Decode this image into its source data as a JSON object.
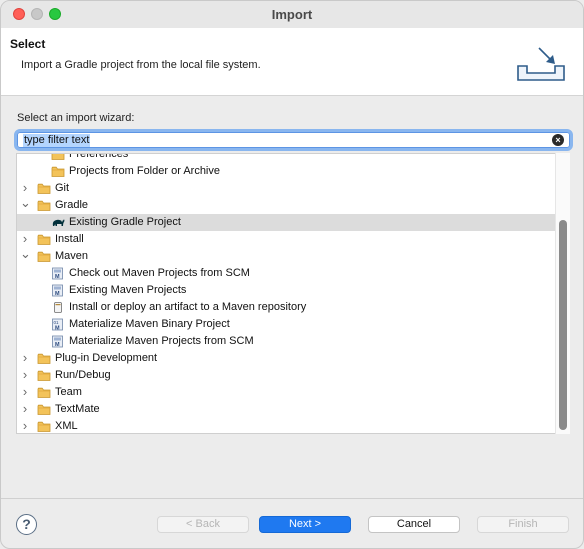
{
  "window": {
    "title": "Import"
  },
  "banner": {
    "title": "Select",
    "message": "Import a Gradle project from the local file system."
  },
  "wizard": {
    "label": "Select an import wizard:",
    "filter_value": "type filter text"
  },
  "tree": [
    {
      "label": "Preferences",
      "level": 1,
      "icon": "preferences-icon",
      "twisty": ""
    },
    {
      "label": "Projects from Folder or Archive",
      "level": 1,
      "icon": "folder-icon",
      "twisty": ""
    },
    {
      "label": "Git",
      "level": 0,
      "icon": "folder-icon",
      "twisty": "collapsed"
    },
    {
      "label": "Gradle",
      "level": 0,
      "icon": "folder-icon",
      "twisty": "expanded"
    },
    {
      "label": "Existing Gradle Project",
      "level": 1,
      "icon": "gradle-elephant-icon",
      "twisty": "",
      "selected": true
    },
    {
      "label": "Install",
      "level": 0,
      "icon": "folder-icon",
      "twisty": "collapsed"
    },
    {
      "label": "Maven",
      "level": 0,
      "icon": "folder-icon",
      "twisty": "expanded"
    },
    {
      "label": "Check out Maven Projects from SCM",
      "level": 1,
      "icon": "maven-icon",
      "twisty": ""
    },
    {
      "label": "Existing Maven Projects",
      "level": 1,
      "icon": "maven-icon",
      "twisty": ""
    },
    {
      "label": "Install or deploy an artifact to a Maven repository",
      "level": 1,
      "icon": "jar-icon",
      "twisty": ""
    },
    {
      "label": "Materialize Maven Binary Project",
      "level": 1,
      "icon": "maven-binary-icon",
      "twisty": ""
    },
    {
      "label": "Materialize Maven Projects from SCM",
      "level": 1,
      "icon": "maven-icon",
      "twisty": ""
    },
    {
      "label": "Plug-in Development",
      "level": 0,
      "icon": "folder-icon",
      "twisty": "collapsed"
    },
    {
      "label": "Run/Debug",
      "level": 0,
      "icon": "folder-icon",
      "twisty": "collapsed"
    },
    {
      "label": "Team",
      "level": 0,
      "icon": "folder-icon",
      "twisty": "collapsed"
    },
    {
      "label": "TextMate",
      "level": 0,
      "icon": "folder-icon",
      "twisty": "collapsed"
    },
    {
      "label": "XML",
      "level": 0,
      "icon": "folder-icon",
      "twisty": "collapsed"
    }
  ],
  "buttons": {
    "back": "< Back",
    "next": "Next >",
    "cancel": "Cancel",
    "finish": "Finish"
  },
  "colors": {
    "primary_button": "#1f79f0",
    "selection": "#dcdcdc",
    "filter_focus": "#89b6ef"
  }
}
